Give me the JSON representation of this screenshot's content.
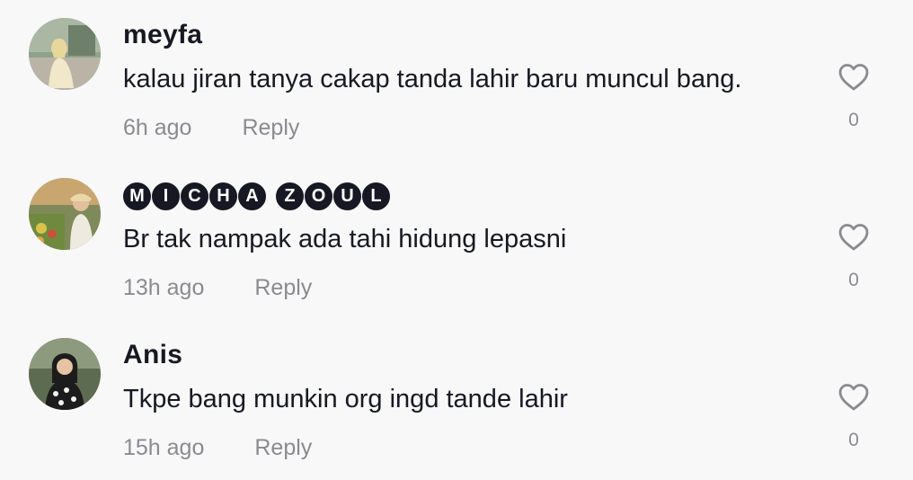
{
  "comments": [
    {
      "username": "meyfa",
      "text": "kalau jiran tanya cakap tanda lahir baru muncul bang.",
      "time": "6h ago",
      "reply_label": "Reply",
      "like_count": "0"
    },
    {
      "username": "MICHA ZOUL",
      "username_chars": [
        "M",
        "I",
        "C",
        "H",
        "A",
        " ",
        "Z",
        "O",
        "U",
        "L"
      ],
      "text": "Br tak nampak ada tahi hidung lepasni",
      "time": "13h ago",
      "reply_label": "Reply",
      "like_count": "0"
    },
    {
      "username": "Anis",
      "text": "Tkpe bang munkin org ingd tande lahir",
      "time": "15h ago",
      "reply_label": "Reply",
      "like_count": "0"
    }
  ],
  "icons": {
    "like": "heart-outline-icon"
  },
  "colors": {
    "background": "#f8f8f8",
    "primary_text": "#161823",
    "secondary_text": "#8a8b91"
  }
}
